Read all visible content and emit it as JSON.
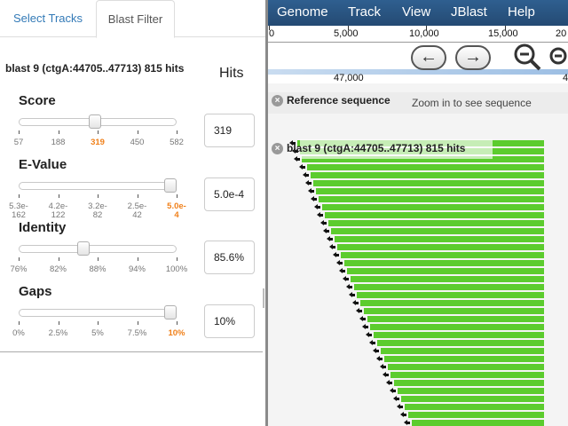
{
  "tabs": [
    "Select Tracks",
    "Blast Filter"
  ],
  "blast_title": "blast 9 (ctgA:44705..47713) 815 hits",
  "hits_label": "Hits",
  "filters": [
    {
      "label": "Score",
      "value": "319",
      "level": 0.48,
      "ticks": [
        "57",
        "188",
        "319",
        "450",
        "582"
      ],
      "active": 2
    },
    {
      "label": "E-Value",
      "value": "5.0e-4",
      "level": 1.0,
      "ticks": [
        "5.3e-\n162",
        "4.2e-\n122",
        "3.2e-\n82",
        "2.5e-\n42",
        "5.0e-\n4"
      ],
      "active": 4
    },
    {
      "label": "Identity",
      "value": "85.6%",
      "level": 0.4,
      "ticks": [
        "76%",
        "82%",
        "88%",
        "94%",
        "100%"
      ],
      "active": -1
    },
    {
      "label": "Gaps",
      "value": "10%",
      "level": 1.0,
      "ticks": [
        "0%",
        "2.5%",
        "5%",
        "7.5%",
        "10%"
      ],
      "active": 4
    }
  ],
  "menu": [
    "Genome",
    "Track",
    "View",
    "JBlast",
    "Help"
  ],
  "ruler_labels": [
    "0",
    "5,000",
    "10,000",
    "15,000",
    "20"
  ],
  "position_labels": [
    "47,000",
    "4"
  ],
  "nav": {
    "left_icon": "arrow-left-icon",
    "right_icon": "arrow-right-icon",
    "zoom_in_icon": "zoom-in-icon",
    "zoom_out_icon": "zoom-out-icon"
  },
  "reference_track": {
    "label": "Reference sequence",
    "message": "Zoom in to see sequence"
  },
  "blast_track": {
    "label": "blast 9 (ctgA:44705..47713) 815 hits"
  },
  "colors": {
    "menubar": "#2f5f90",
    "feature": "#5ccc2e",
    "accent": "#f0801a",
    "link": "#337ab7"
  }
}
